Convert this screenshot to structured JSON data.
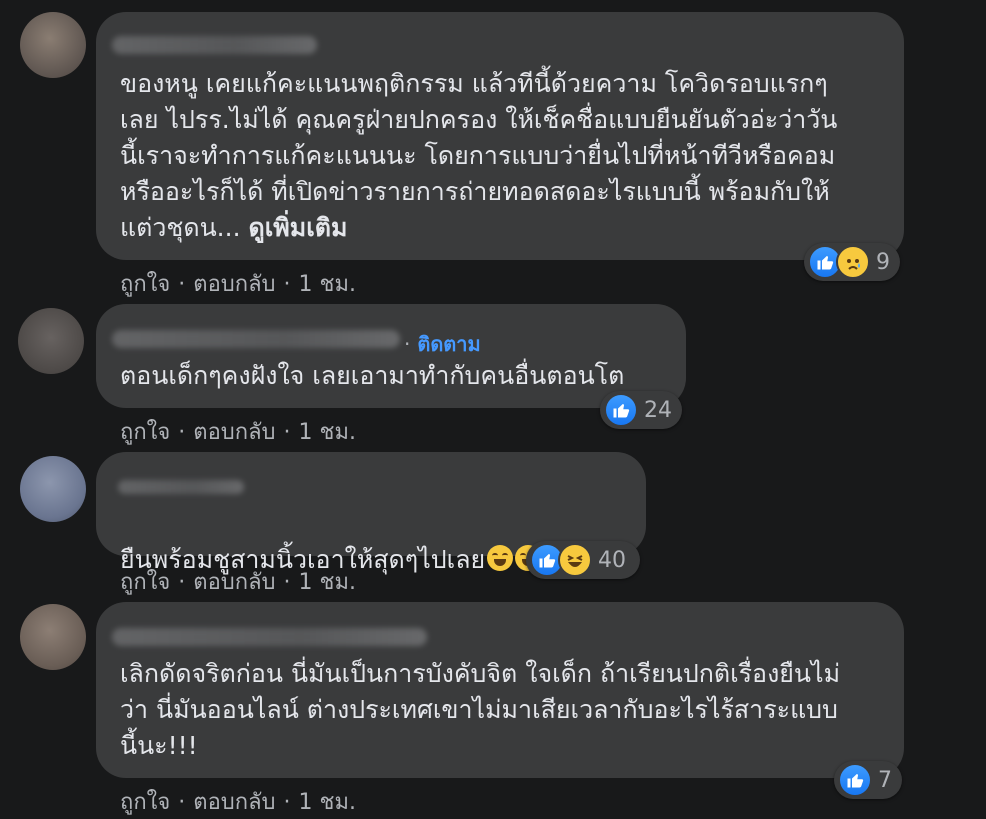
{
  "actions": {
    "like": "ถูกใจ",
    "reply": "ตอบกลับ",
    "separator": "·"
  },
  "comments": [
    {
      "text": "ของหนู เคยแก้คะแนนพฤติกรรม แล้วทีนี้ด้วยความ โควิดรอบแรกๆ\nเลย ไปรร.ไม่ได้ คุณครูฝ่ายปกครอง ให้เช็คชื่อแบบยืนยันตัวอ่ะว่าวัน\nนี้เราจะทำการแก้คะแนนนะ โดยการแบบว่ายื่นไปที่หน้าทีวีหรือคอม\nหรืออะไรก็ได้ ที่เปิดข่าวรายการถ่ายทอดสดอะไรแบบนี้ พร้อมกับให้\nแต่วชุดน...",
      "see_more": "ดูเพิ่มเติม",
      "time": "1 ชม.",
      "reaction_count": "9",
      "reactions": [
        "like",
        "sad"
      ]
    },
    {
      "follow": "ติดตาม",
      "text": "ตอนเด็กๆคงฝังใจ เลยเอามาทำกับคนอื่นตอนโต",
      "time": "1 ชม.",
      "reaction_count": "24",
      "reactions": [
        "like"
      ]
    },
    {
      "text": "ยืนพร้อมชูสามนิ้วเอาให้สุดๆไปเลย",
      "emojis": [
        "rolling-on-floor-laughing",
        "rolling-on-floor-laughing",
        "rolling-on-floor-laughing"
      ],
      "time": "1 ชม.",
      "reaction_count": "40",
      "reactions": [
        "like",
        "haha"
      ]
    },
    {
      "text": "เลิกดัดจริตก่อน นี่มันเป็นการบังคับจิต ใจเด็ก ถ้าเรียนปกติเรื่องยืนไม่\nว่า นี่มันออนไลน์ ต่างประเทศเขาไม่มาเสียเวลากับอะไรไร้สาระแบบ\nนี้นะ!!!",
      "time": "1 ชม.",
      "reaction_count": "7",
      "reactions": [
        "like"
      ]
    }
  ]
}
